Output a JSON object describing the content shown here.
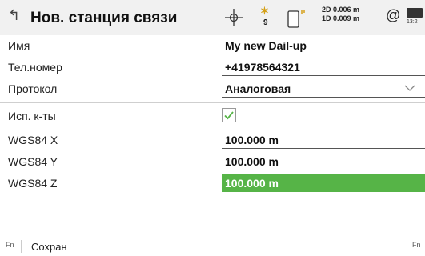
{
  "header": {
    "back_glyph": "↰",
    "title": "Нов. станция связи",
    "satellite_count": "9",
    "precision_2d": "2D 0.006 m",
    "precision_1d": "1D 0.009 m",
    "at_symbol": "@",
    "battery_time": "13:2",
    "icons": [
      "back-arrow-icon",
      "crosshair-icon",
      "satellite-icon",
      "device-icon",
      "at-icon",
      "battery-icon"
    ]
  },
  "form": {
    "name": {
      "label": "Имя",
      "value": "My new Dail-up"
    },
    "phone": {
      "label": "Тел.номер",
      "value": "+41978564321"
    },
    "protocol": {
      "label": "Протокол",
      "value": "Аналоговая"
    },
    "use_coords": {
      "label": "Исп. к-ты",
      "checked": true
    },
    "wgs_x": {
      "label": "WGS84 X",
      "value": "100.000 m"
    },
    "wgs_y": {
      "label": "WGS84 Y",
      "value": "100.000 m"
    },
    "wgs_z": {
      "label": "WGS84 Z",
      "value": "100.000 m"
    }
  },
  "footer": {
    "fn_left": "Fn",
    "save_label": "Сохран",
    "fn_right": "Fn"
  },
  "colors": {
    "active_field": "#56b447",
    "checkmark": "#56b447",
    "satellite": "#d4a017",
    "device_accent": "#d4a017"
  }
}
